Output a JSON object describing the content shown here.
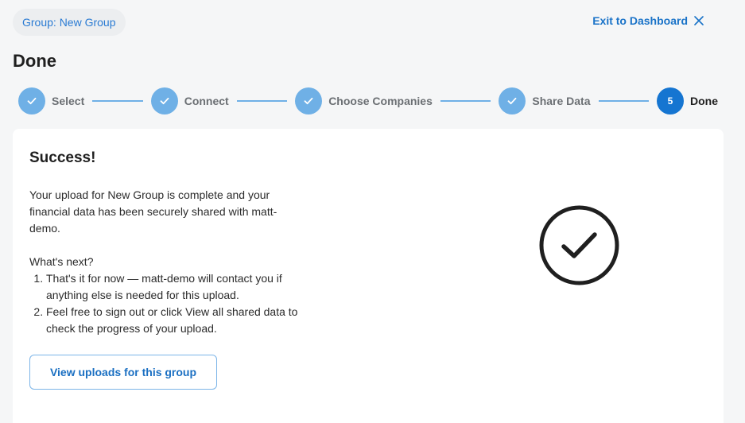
{
  "header": {
    "group_label": "Group: New Group",
    "exit_label": "Exit to Dashboard",
    "page_title": "Done"
  },
  "stepper": {
    "steps": [
      {
        "label": "Select",
        "state": "complete"
      },
      {
        "label": "Connect",
        "state": "complete"
      },
      {
        "label": "Choose Companies",
        "state": "complete"
      },
      {
        "label": "Share Data",
        "state": "complete"
      },
      {
        "label": "Done",
        "number": "5",
        "state": "active"
      }
    ]
  },
  "card": {
    "title": "Success!",
    "message": "Your upload for New Group is complete and your financial data has been securely shared with matt-demo.",
    "next_heading": "What's next?",
    "next_items": [
      "That's it for now — matt-demo will contact you if anything else is needed for this upload.",
      "Feel free to sign out or click View all shared data to check the progress of your upload."
    ],
    "button_label": "View uploads for this group"
  },
  "colors": {
    "accent": "#1575d1",
    "step_complete": "#6fb0e6",
    "link": "#1a73c8"
  },
  "icons": {
    "exit": "close-icon",
    "step_complete": "check-icon",
    "success": "check-circle-icon"
  }
}
